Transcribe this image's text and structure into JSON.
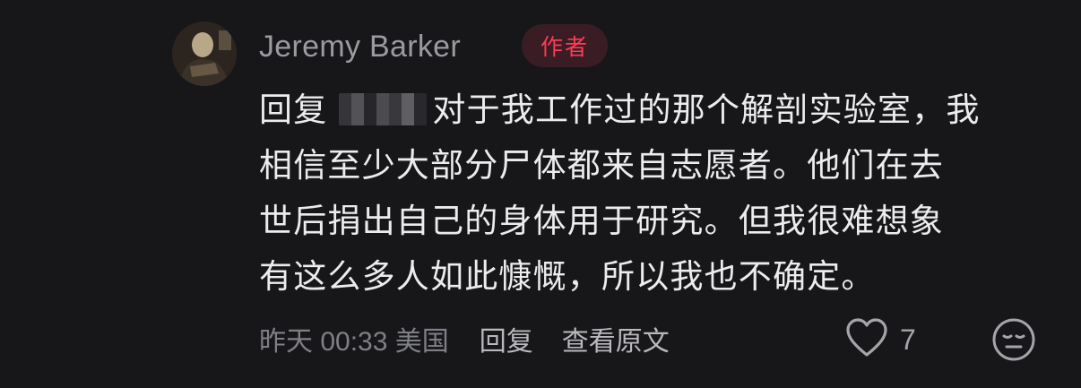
{
  "comment": {
    "author_name": "Jeremy Barker",
    "author_badge": "作者",
    "reply_prefix": "回复",
    "body_lines": [
      "对于我工作过的那个解剖实验室，我",
      "相信至少大部分尸体都来自志愿者。他们在去",
      "世后捐出自己的身体用于研究。但我很难想象",
      "有这么多人如此慷慨，所以我也不确定。"
    ],
    "timestamp": "昨天 00:33 美国",
    "reply_label": "回复",
    "view_original_label": "查看原文",
    "like_count": "7",
    "colors": {
      "background": "#17171a",
      "badge_text": "#ff3b55",
      "badge_bg": "#3a1d24",
      "meta_text": "#8a8a90",
      "body_text": "#ececee"
    },
    "icons": {
      "like": "heart-outline-icon",
      "emoji": "face-emoji-icon"
    }
  }
}
